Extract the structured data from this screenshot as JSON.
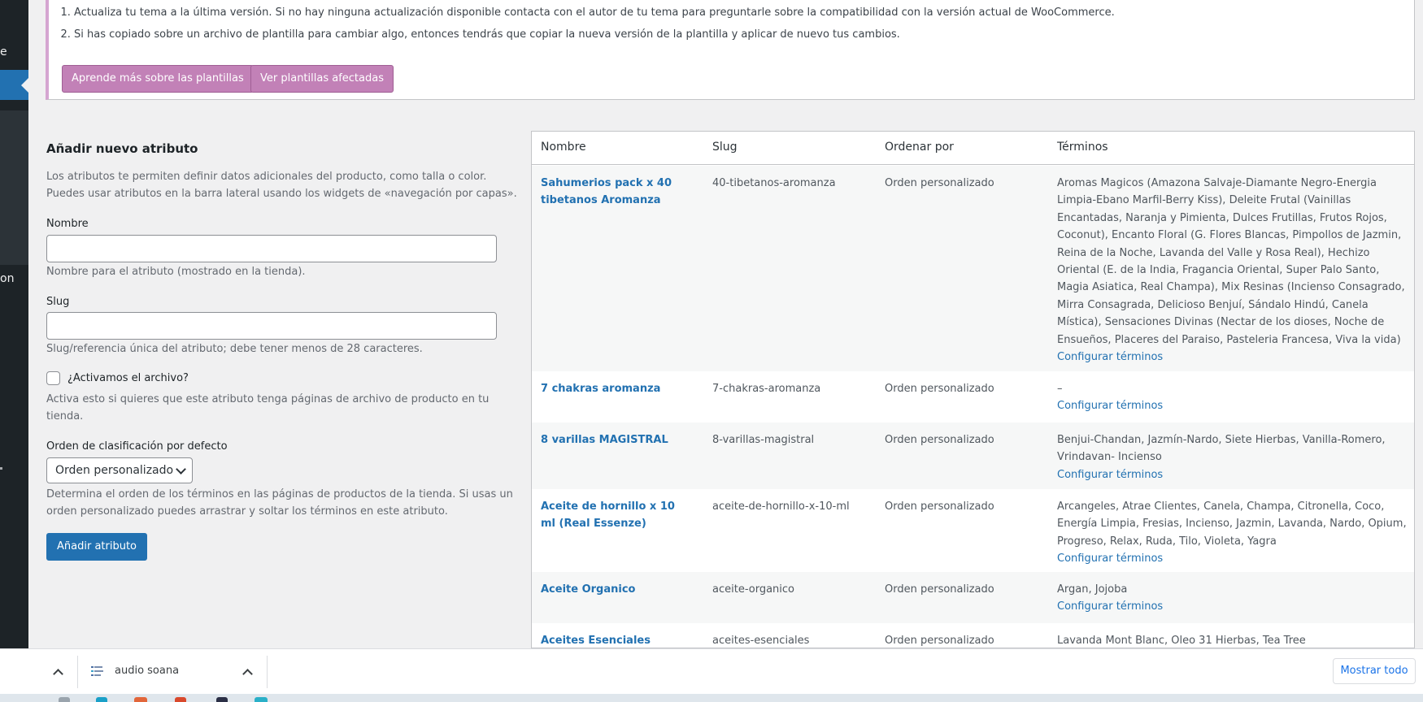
{
  "sidebar": {
    "partial_labels": [
      "e",
      "on"
    ]
  },
  "notice": {
    "items": [
      "Actualiza tu tema a la última versión. Si no hay ninguna actualización disponible contacta con el autor de tu tema para preguntarle sobre la compatibilidad con la versión actual de WooCommerce.",
      "Si has copiado sobre un archivo de plantilla para cambiar algo, entonces tendrás que copiar la nueva versión de la plantilla y aplicar de nuevo tus cambios."
    ],
    "buttons": {
      "learn": "Aprende más sobre las plantillas",
      "view": "Ver plantillas afectadas"
    }
  },
  "form": {
    "title": "Añadir nuevo atributo",
    "intro": "Los atributos te permiten definir datos adicionales del producto, como talla o color. Puedes usar atributos en la barra lateral usando los widgets de «navegación por capas».",
    "name_label": "Nombre",
    "name_value": "",
    "name_help": "Nombre para el atributo (mostrado en la tienda).",
    "slug_label": "Slug",
    "slug_value": "",
    "slug_help": "Slug/referencia única del atributo; debe tener menos de 28 caracteres.",
    "archive_label": "¿Activamos el archivo?",
    "archive_checked": false,
    "archive_help": "Activa esto si quieres que este atributo tenga páginas de archivo de producto en tu tienda.",
    "order_label": "Orden de clasificación por defecto",
    "order_value": "Orden personalizado",
    "order_help": "Determina el orden de los términos en las páginas de productos de la tienda. Si usas un orden personalizado puedes arrastrar y soltar los términos en este atributo.",
    "submit": "Añadir atributo"
  },
  "table": {
    "headers": {
      "name": "Nombre",
      "slug": "Slug",
      "order": "Ordenar por",
      "terms": "Términos"
    },
    "configure_label": "Configurar términos",
    "rows": [
      {
        "name": "Sahumerios pack x 40 tibetanos Aromanza",
        "slug": "40-tibetanos-aromanza",
        "order": "Orden personalizado",
        "terms": "Aromas Magicos (Amazona Salvaje-Diamante Negro-Energia Limpia-Ebano Marfil-Berry Kiss), Deleite Frutal (Vainillas Encantadas, Naranja y Pimienta, Dulces Frutillas, Frutos Rojos, Coconut), Encanto Floral (G. Flores Blancas, Pimpollos de Jazmin, Reina de la Noche, Lavanda del Valle y Rosa Real), Hechizo Oriental (E. de la India, Fragancia Oriental, Super Palo Santo, Magia Asiatica, Real Champa), Mix Resinas (Incienso Consagrado, Mirra Consagrada, Delicioso Benjuí, Sándalo Hindú, Canela Mística), Sensaciones Divinas (Nectar de los dioses, Noche de Ensueños, Placeres del Paraiso, Pasteleria Francesa, Viva la vida)"
      },
      {
        "name": "7 chakras aromanza",
        "slug": "7-chakras-aromanza",
        "order": "Orden personalizado",
        "terms": "–"
      },
      {
        "name": "8 varillas MAGISTRAL",
        "slug": "8-varillas-magistral",
        "order": "Orden personalizado",
        "terms": "Benjui-Chandan, Jazmín-Nardo, Siete Hierbas, Vanilla-Romero, Vrindavan- Incienso"
      },
      {
        "name": "Aceite de hornillo x 10 ml (Real Essenze)",
        "slug": "aceite-de-hornillo-x-10-ml",
        "order": "Orden personalizado",
        "terms": "Arcangeles, Atrae Clientes, Canela, Champa, Citronella, Coco, Energía Limpia, Fresias, Incienso, Jazmin, Lavanda, Nardo, Opium, Progreso, Relax, Ruda, Tilo, Violeta, Yagra"
      },
      {
        "name": "Aceite Organico",
        "slug": "aceite-organico",
        "order": "Orden personalizado",
        "terms": "Argan, Jojoba"
      },
      {
        "name": "Aceites Esenciales",
        "slug": "aceites-esenciales",
        "order": "Orden personalizado",
        "terms": "Lavanda Mont Blanc, Oleo 31 Hierbas, Tea Tree"
      }
    ]
  },
  "downloads": {
    "file_name": "audio soana",
    "show_all": "Mostrar todo"
  }
}
